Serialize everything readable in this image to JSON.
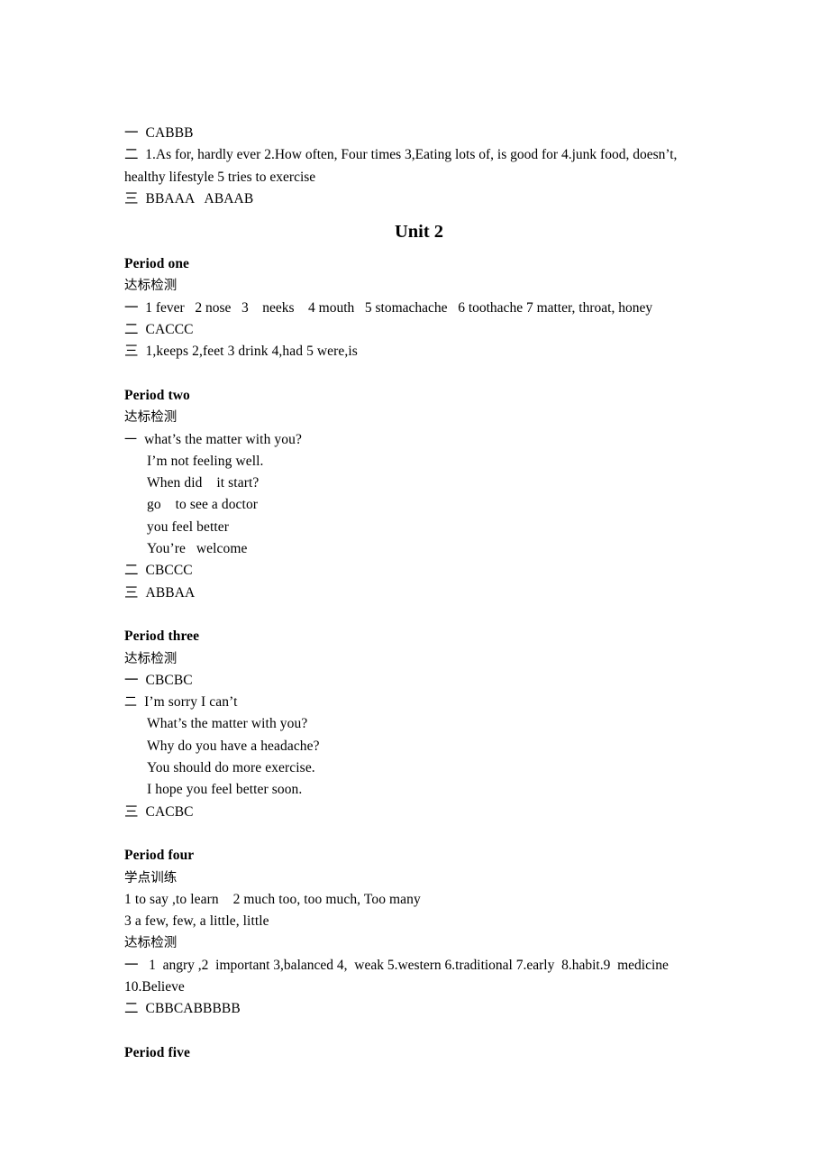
{
  "document": {
    "type": "answer-key-worksheet",
    "background_color": "#ffffff",
    "text_color": "#000000"
  },
  "unit_one_tail": {
    "line1": "一  CABBB",
    "line2": "二  1.As for, hardly ever 2.How often, Four times 3,Eating lots of, is good for 4.junk food, doesn’t, healthy lifestyle 5 tries to exercise",
    "line3": "三  BBAAA   ABAAB"
  },
  "unit_title": "Unit 2",
  "period_one": {
    "heading": "Period one",
    "subheading": "达标检测",
    "line1": "一  1 fever   2 nose   3    neeks    4 mouth   5 stomachache   6 toothache 7 matter, throat, honey",
    "line2": "二  CACCC",
    "line3": "三  1,keeps 2,feet 3 drink 4,had 5 were,is"
  },
  "period_two": {
    "heading": "Period two",
    "subheading": "达标检测",
    "item_one_marker": "一",
    "answers": [
      "what’s the matter with you?",
      "I’m not feeling well.",
      "When did    it start?",
      "go    to see a doctor",
      "you feel better",
      "You’re   welcome"
    ],
    "line2": "二  CBCCC",
    "line3": "三  ABBAA"
  },
  "period_three": {
    "heading": "Period three",
    "subheading": "达标检测",
    "line1": "一  CBCBC",
    "item_two_marker": "二",
    "answers": [
      "I’m sorry I can’t",
      "What’s the matter with you?",
      "Why do you have a headache?",
      "You should do more exercise.",
      "I hope you feel better soon."
    ],
    "line3": "三  CACBC"
  },
  "period_four": {
    "heading": "Period four",
    "subheading_a": "学点训练",
    "practice_line1": "1 to say ,to learn    2 much too, too much, Too many",
    "practice_line2": "3 a few, few, a little, little",
    "subheading_b": "达标检测",
    "line1": "一   1  angry ,2  important 3,balanced 4,  weak 5.western 6.traditional 7.early  8.habit.9  medicine 10.Believe",
    "line2": "二  CBBCABBBBB"
  },
  "period_five": {
    "heading": "Period five"
  }
}
